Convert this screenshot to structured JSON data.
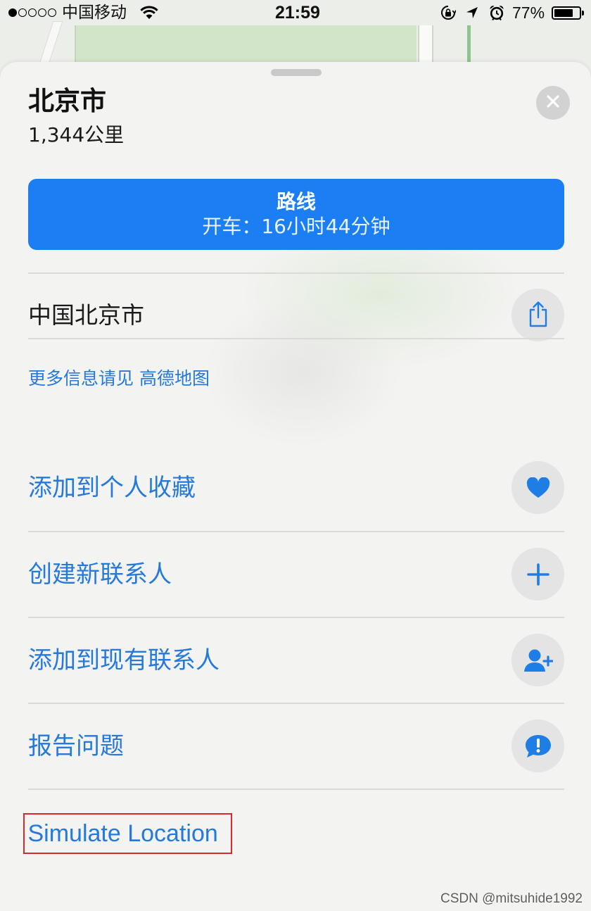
{
  "status_bar": {
    "signal_strength": 1,
    "signal_max": 5,
    "carrier": "中国移动",
    "time": "21:59",
    "battery_text": "77%",
    "battery_level": 0.77,
    "icons": {
      "wifi": "wifi-icon",
      "rotation_lock": "rotation-lock-icon",
      "location": "location-arrow-icon",
      "alarm": "alarm-icon",
      "battery": "battery-icon"
    }
  },
  "place_card": {
    "title": "北京市",
    "distance": "1,344公里",
    "close_icon": "close-icon",
    "directions": {
      "label": "路线",
      "detail": "开车：16小时44分钟"
    },
    "address": "中国北京市",
    "share_icon": "share-icon",
    "more_info": "更多信息请见 高德地图",
    "actions": [
      {
        "label": "添加到个人收藏",
        "icon": "heart-icon"
      },
      {
        "label": "创建新联系人",
        "icon": "plus-icon"
      },
      {
        "label": "添加到现有联系人",
        "icon": "add-person-icon"
      },
      {
        "label": "报告问题",
        "icon": "report-bubble-icon"
      }
    ],
    "simulate_location": "Simulate Location"
  },
  "watermark": "CSDN @mitsuhide1992",
  "colors": {
    "accent": "#1b7ef3",
    "link_text": "#2479db",
    "sheet_background": "#f3f3f1",
    "icon_circle": "#e4e4e4",
    "highlight_border": "#d7282e"
  }
}
